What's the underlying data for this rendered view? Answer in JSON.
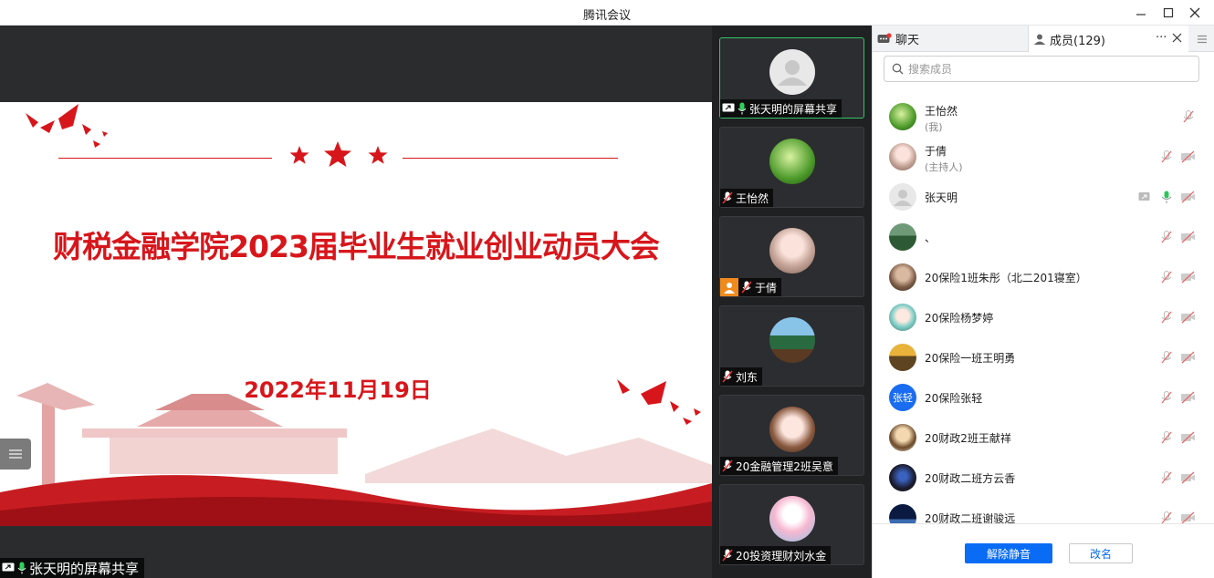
{
  "window": {
    "title": "腾讯会议",
    "minimize_icon": "minimize-icon",
    "maximize_icon": "maximize-icon",
    "close_icon": "close-icon"
  },
  "slide": {
    "title": "财税金融学院2023届毕业生就业创业动员大会",
    "date": "2022年11月19日",
    "accent_color": "#d7161b"
  },
  "share_label": "张天明的屏幕共享",
  "tiles": [
    {
      "name": "张天明的屏幕共享",
      "avatar": "default",
      "muted": false,
      "sharing": true,
      "active": true
    },
    {
      "name": "王怡然",
      "avatar": "green",
      "muted": true
    },
    {
      "name": "于倩",
      "avatar": "girl",
      "muted": true,
      "host": true
    },
    {
      "name": "刘东",
      "avatar": "scene",
      "muted": true
    },
    {
      "name": "20金融管理2班吴意",
      "avatar": "girl2",
      "muted": true
    },
    {
      "name": "20投资理财刘水金",
      "avatar": "cartoon",
      "muted": true
    }
  ],
  "panel": {
    "tab_chat": "聊天",
    "tab_members": "成员(129)",
    "search_placeholder": "搜索成员",
    "members": [
      {
        "name": "王怡然",
        "role": "(我)",
        "avatar": "green"
      },
      {
        "name": "于倩",
        "role": "(主持人)",
        "avatar": "girl"
      },
      {
        "name": "张天明",
        "role": "",
        "avatar": "default"
      },
      {
        "name": "、",
        "role": "",
        "avatar": "landscape"
      },
      {
        "name": "20保险1班朱彤（北二201寝室）",
        "role": "",
        "avatar": "person"
      },
      {
        "name": "20保险杨梦婷",
        "role": "",
        "avatar": "anime"
      },
      {
        "name": "20保险一班王明勇",
        "role": "",
        "avatar": "sunset"
      },
      {
        "name": "20保险张轻",
        "role": "",
        "avatar": "text",
        "avatar_text": "张轻"
      },
      {
        "name": "20财政2班王献祥",
        "role": "",
        "avatar": "cartoon2"
      },
      {
        "name": "20财政二班方云香",
        "role": "",
        "avatar": "dark"
      },
      {
        "name": "20财政二班谢骏远",
        "role": "",
        "avatar": "night"
      }
    ],
    "unmute_button": "解除静音",
    "rename_button": "改名"
  }
}
